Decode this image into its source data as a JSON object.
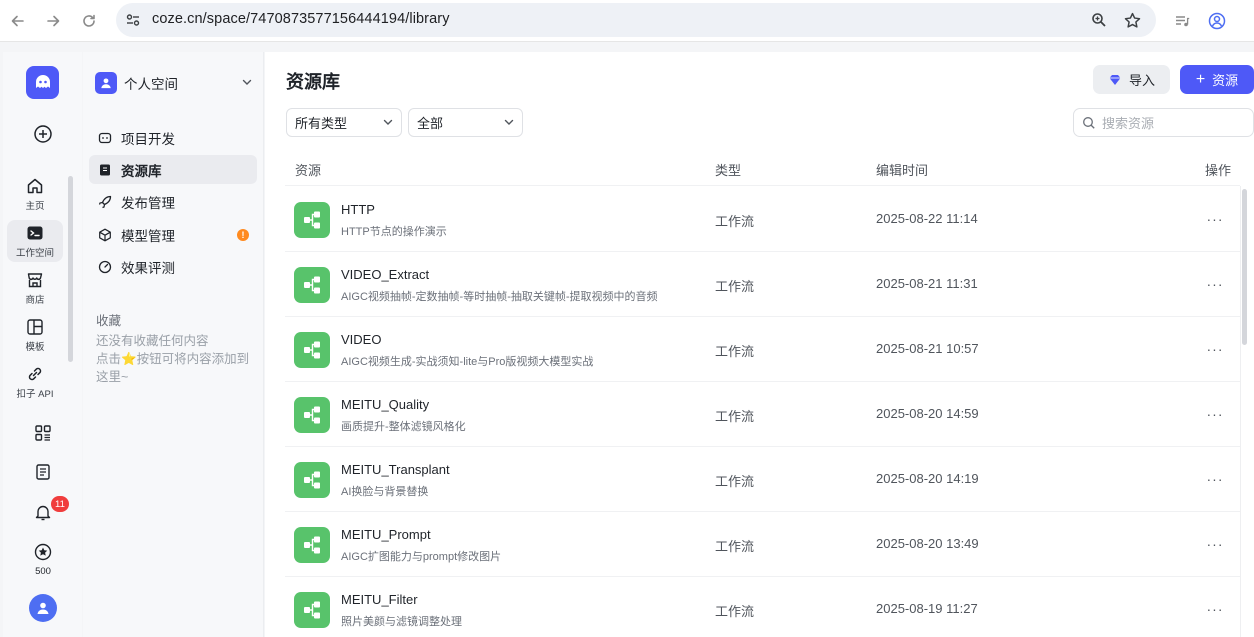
{
  "browser": {
    "url": "coze.cn/space/7470873577156444194/library"
  },
  "rail": {
    "items": [
      {
        "label": "主页"
      },
      {
        "label": "工作空间"
      },
      {
        "label": "商店"
      },
      {
        "label": "模板"
      },
      {
        "label": "扣子 API"
      }
    ],
    "notification_count": "11",
    "credits": "500"
  },
  "sidebar": {
    "space_name": "个人空间",
    "items": [
      {
        "label": "项目开发"
      },
      {
        "label": "资源库"
      },
      {
        "label": "发布管理"
      },
      {
        "label": "模型管理"
      },
      {
        "label": "效果评测"
      }
    ],
    "model_badge": "!",
    "favorites_title": "收藏",
    "favorites_empty_1": "还没有收藏任何内容",
    "favorites_empty_2": "点击⭐按钮可将内容添加到这里~"
  },
  "main": {
    "title": "资源库",
    "import_label": "导入",
    "add_resource_label": "资源",
    "filter_type": "所有类型",
    "filter_scope": "全部",
    "search_placeholder": "搜索资源",
    "columns": {
      "resource": "资源",
      "type": "类型",
      "edit_time": "编辑时间",
      "actions": "操作"
    },
    "rows": [
      {
        "name": "HTTP",
        "desc": "HTTP节点的操作演示",
        "type": "工作流",
        "time": "2025-08-22 11:14"
      },
      {
        "name": "VIDEO_Extract",
        "desc": "AIGC视频抽帧-定数抽帧-等时抽帧-抽取关键帧-提取视频中的音频",
        "type": "工作流",
        "time": "2025-08-21 11:31"
      },
      {
        "name": "VIDEO",
        "desc": "AIGC视频生成-实战须知-lite与Pro版视频大模型实战",
        "type": "工作流",
        "time": "2025-08-21 10:57"
      },
      {
        "name": "MEITU_Quality",
        "desc": "画质提升-整体滤镜风格化",
        "type": "工作流",
        "time": "2025-08-20 14:59"
      },
      {
        "name": "MEITU_Transplant",
        "desc": "AI换脸与背景替换",
        "type": "工作流",
        "time": "2025-08-20 14:19"
      },
      {
        "name": "MEITU_Prompt",
        "desc": "AIGC扩图能力与prompt修改图片",
        "type": "工作流",
        "time": "2025-08-20 13:49"
      },
      {
        "name": "MEITU_Filter",
        "desc": "照片美颜与滤镜调整处理",
        "type": "工作流",
        "time": "2025-08-19 11:27"
      }
    ],
    "more_glyph": "···"
  },
  "colors": {
    "brand": "#4e59f7",
    "workflow_icon": "#58c36b",
    "badge_red": "#f03d3d",
    "badge_orange": "#ff8a1f"
  }
}
